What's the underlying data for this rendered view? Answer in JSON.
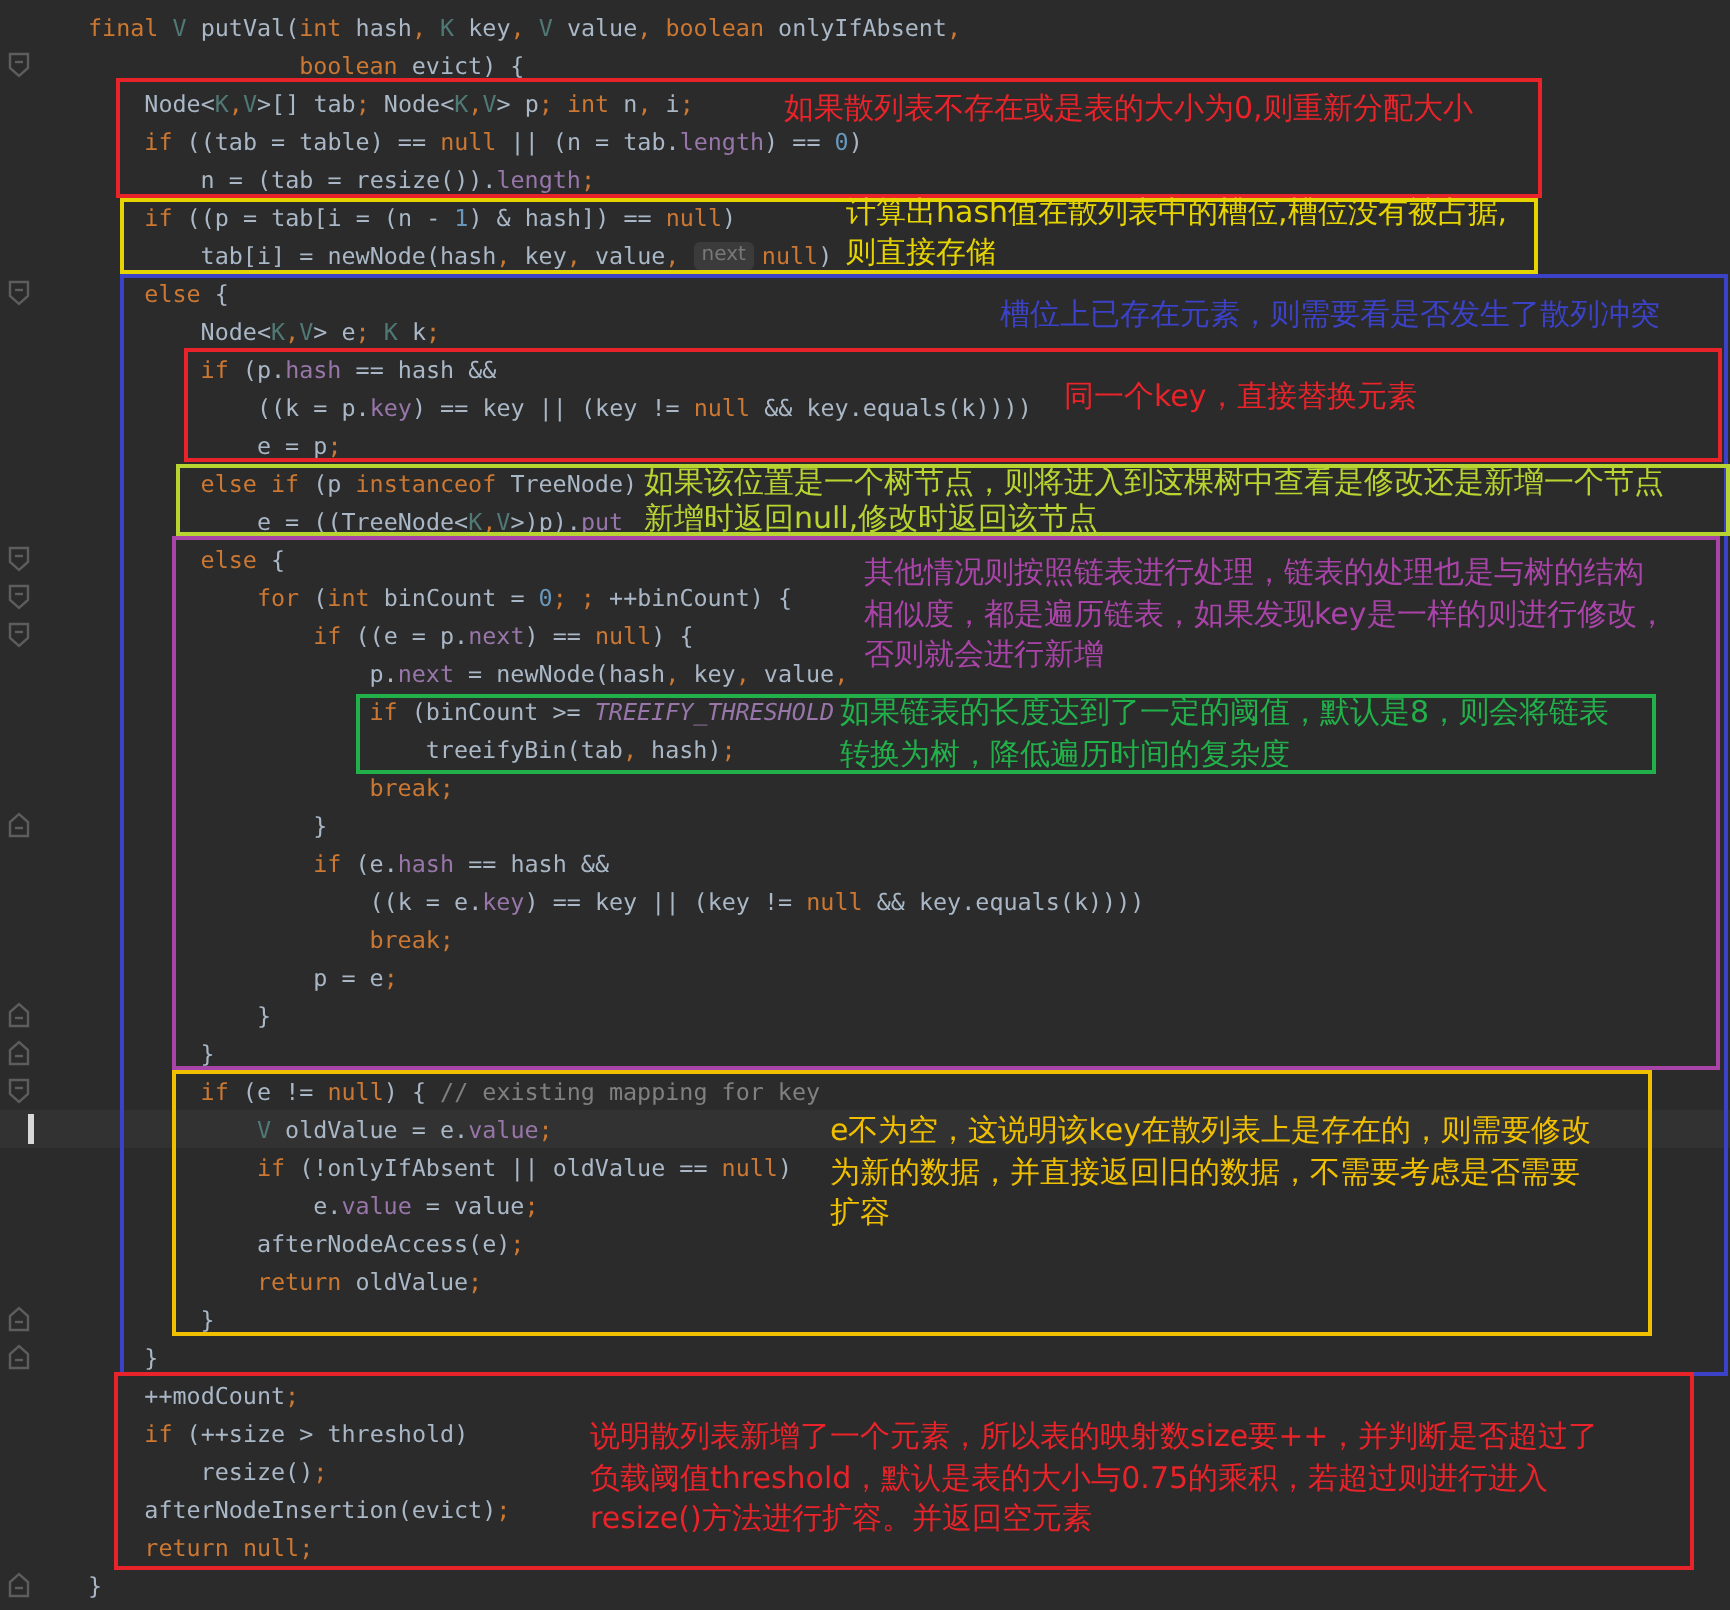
{
  "editor": {
    "lines": [
      {
        "code": "final V putVal(int hash, K key, V value, boolean onlyIfAbsent,",
        "fold_start": false,
        "fold_end": false,
        "current": false
      },
      {
        "code": "               boolean evict) {",
        "fold_start": true,
        "fold_end": false,
        "current": false
      },
      {
        "code": "    Node<K,V>[] tab; Node<K,V> p; int n, i;",
        "fold_start": false,
        "fold_end": false,
        "current": false
      },
      {
        "code": "    if ((tab = table) == null || (n = tab.length) == 0)",
        "fold_start": false,
        "fold_end": false,
        "current": false
      },
      {
        "code": "        n = (tab = resize()).length;",
        "fold_start": false,
        "fold_end": false,
        "current": false
      },
      {
        "code": "    if ((p = tab[i = (n - 1) & hash]) == null)",
        "fold_start": false,
        "fold_end": false,
        "current": false
      },
      {
        "code": "        tab[i] = newNode(hash, key, value, ",
        "hint": "next",
        "after": "null)",
        "fold_start": false,
        "fold_end": false,
        "current": false
      },
      {
        "code": "    else {",
        "fold_start": true,
        "fold_end": false,
        "current": false
      },
      {
        "code": "        Node<K,V> e; K k;",
        "fold_start": false,
        "fold_end": false,
        "current": false
      },
      {
        "code": "        if (p.hash == hash &&",
        "fold_start": false,
        "fold_end": false,
        "current": false
      },
      {
        "code": "            ((k = p.key) == key || (key != null && key.equals(k))))",
        "fold_start": false,
        "fold_end": false,
        "current": false
      },
      {
        "code": "            e = p;",
        "fold_start": false,
        "fold_end": false,
        "current": false
      },
      {
        "code": "        else if (p instanceof TreeNode)",
        "fold_start": false,
        "fold_end": false,
        "current": false
      },
      {
        "code": "            e = ((TreeNode<K,V>)p).put",
        "fold_start": false,
        "fold_end": false,
        "current": false
      },
      {
        "code": "        else {",
        "fold_start": true,
        "fold_end": false,
        "current": false
      },
      {
        "code": "            for (int binCount = 0; ; ++binCount) {",
        "fold_start": true,
        "fold_end": false,
        "current": false
      },
      {
        "code": "                if ((e = p.next) == null) {",
        "fold_start": true,
        "fold_end": false,
        "current": false
      },
      {
        "code": "                    p.next = newNode(hash, key, value,",
        "fold_start": false,
        "fold_end": false,
        "current": false
      },
      {
        "code": "                    if (binCount >= TREEIFY_THRESHOLD",
        "fold_start": false,
        "fold_end": false,
        "current": false
      },
      {
        "code": "                        treeifyBin(tab, hash);",
        "fold_start": false,
        "fold_end": false,
        "current": false
      },
      {
        "code": "                    break;",
        "fold_start": false,
        "fold_end": false,
        "current": false
      },
      {
        "code": "                }",
        "fold_start": false,
        "fold_end": true,
        "current": false
      },
      {
        "code": "                if (e.hash == hash &&",
        "fold_start": false,
        "fold_end": false,
        "current": false
      },
      {
        "code": "                    ((k = e.key) == key || (key != null && key.equals(k))))",
        "fold_start": false,
        "fold_end": false,
        "current": false
      },
      {
        "code": "                    break;",
        "fold_start": false,
        "fold_end": false,
        "current": false
      },
      {
        "code": "                p = e;",
        "fold_start": false,
        "fold_end": false,
        "current": false
      },
      {
        "code": "            }",
        "fold_start": false,
        "fold_end": true,
        "current": false
      },
      {
        "code": "        }",
        "fold_start": false,
        "fold_end": true,
        "current": false
      },
      {
        "code": "        if (e != null) { // existing mapping for key",
        "fold_start": true,
        "fold_end": false,
        "current": false
      },
      {
        "code": "            V oldValue = e.value;",
        "fold_start": false,
        "fold_end": false,
        "current": true
      },
      {
        "code": "            if (!onlyIfAbsent || oldValue == null)",
        "fold_start": false,
        "fold_end": false,
        "current": false
      },
      {
        "code": "                e.value = value;",
        "fold_start": false,
        "fold_end": false,
        "current": false
      },
      {
        "code": "            afterNodeAccess(e);",
        "fold_start": false,
        "fold_end": false,
        "current": false
      },
      {
        "code": "            return oldValue;",
        "fold_start": false,
        "fold_end": false,
        "current": false
      },
      {
        "code": "        }",
        "fold_start": false,
        "fold_end": true,
        "current": false
      },
      {
        "code": "    }",
        "fold_start": false,
        "fold_end": true,
        "current": false
      },
      {
        "code": "    ++modCount;",
        "fold_start": false,
        "fold_end": false,
        "current": false
      },
      {
        "code": "    if (++size > threshold)",
        "fold_start": false,
        "fold_end": false,
        "current": false
      },
      {
        "code": "        resize();",
        "fold_start": false,
        "fold_end": false,
        "current": false
      },
      {
        "code": "    afterNodeInsertion(evict);",
        "fold_start": false,
        "fold_end": false,
        "current": false
      },
      {
        "code": "    return null;",
        "fold_start": false,
        "fold_end": false,
        "current": false
      },
      {
        "code": "}",
        "fold_start": false,
        "fold_end": true,
        "current": false
      }
    ]
  },
  "annotations": [
    {
      "color": "#e8232a",
      "lines": [
        "如果散列表不存在或是表的大小为0,则重新分配大小"
      ]
    },
    {
      "color": "#e6d400",
      "lines": [
        "计算出hash值在散列表中的槽位,槽位没有被占据,",
        "则直接存储"
      ]
    },
    {
      "color": "#3c42c8",
      "lines": [
        "槽位上已存在元素，则需要看是否发生了散列冲突"
      ]
    },
    {
      "color": "#e8232a",
      "lines": [
        "同一个key，直接替换元素"
      ]
    },
    {
      "color": "#b8d430",
      "lines": [
        "如果该位置是一个树节点，则将进入到这棵树中查看是修改还是新增一个节点",
        "新增时返回null,修改时返回该节点"
      ]
    },
    {
      "color": "#a844a8",
      "lines": [
        "其他情况则按照链表进行处理，链表的处理也是与树的结构",
        "相似度，都是遍历链表，如果发现key是一样的则进行修改，",
        "否则就会进行新增"
      ]
    },
    {
      "color": "#22b04a",
      "lines": [
        "如果链表的长度达到了一定的阈值，默认是8，则会将链表",
        "转换为树，降低遍历时间的复杂度"
      ]
    },
    {
      "color": "#f0c000",
      "lines": [
        "e不为空，这说明该key在散列表上是存在的，则需要修改",
        "为新的数据，并直接返回旧的数据，不需要考虑是否需要",
        "扩容"
      ]
    },
    {
      "color": "#e8232a",
      "lines": [
        "说明散列表新增了一个元素，所以表的映射数size要++，并判断是否超过了",
        "负载阈值threshold，默认是表的大小与0.75的乘积，若超过则进行进入",
        "resize()方法进行扩容。并返回空元素"
      ]
    }
  ]
}
